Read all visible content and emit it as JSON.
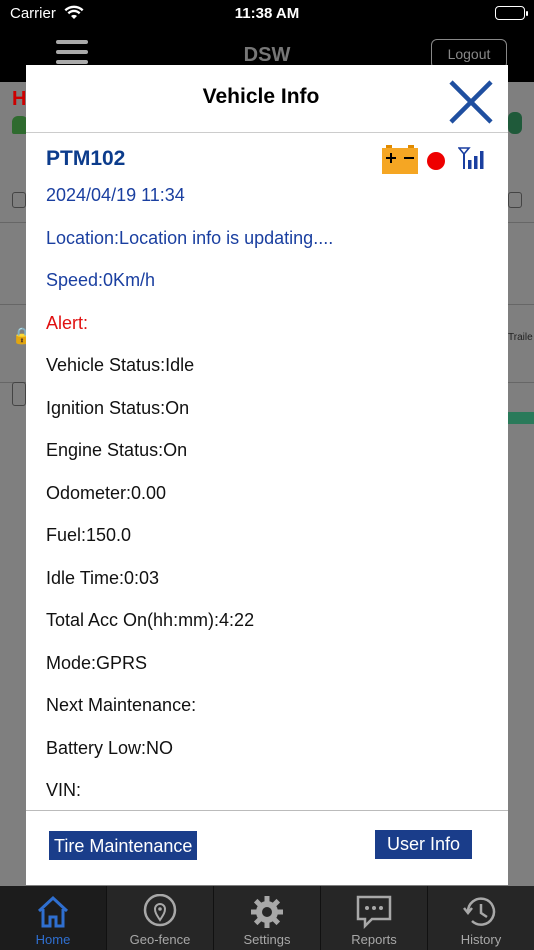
{
  "status_bar": {
    "carrier": "Carrier",
    "time": "11:38 AM"
  },
  "app_header": {
    "title": "DSW",
    "logout_label": "Logout"
  },
  "background": {
    "h_letter": "H",
    "trailer_text": "Traile"
  },
  "modal": {
    "title": "Vehicle Info",
    "plate": "PTM102",
    "datetime": "2024/04/19 11:34",
    "location": "Location:Location info is updating....",
    "speed": "Speed:0Km/h",
    "alert": "Alert:",
    "lines": [
      "Vehicle Status:Idle",
      "Ignition Status:On",
      "Engine Status:On",
      "Odometer:0.00",
      "Fuel:150.0",
      "Idle Time:0:03",
      "Total Acc On(hh:mm):4:22",
      "Mode:GPRS",
      "Next Maintenance:",
      "Battery Low:NO",
      "VIN:"
    ],
    "tire_maintenance_label": "Tire Maintenance",
    "user_info_label": "User Info",
    "colors": {
      "heading_blue": "#0c3c8c",
      "alert_red": "#e01010",
      "button_blue": "#1a3d8a",
      "battery_orange": "#f5a623"
    }
  },
  "tabs": [
    {
      "label": "Home",
      "icon": "home-icon",
      "active": true
    },
    {
      "label": "Geo-fence",
      "icon": "geofence-pin-icon",
      "active": false
    },
    {
      "label": "Settings",
      "icon": "gear-icon",
      "active": false
    },
    {
      "label": "Reports",
      "icon": "chat-bubble-icon",
      "active": false
    },
    {
      "label": "History",
      "icon": "history-clock-icon",
      "active": false
    }
  ]
}
